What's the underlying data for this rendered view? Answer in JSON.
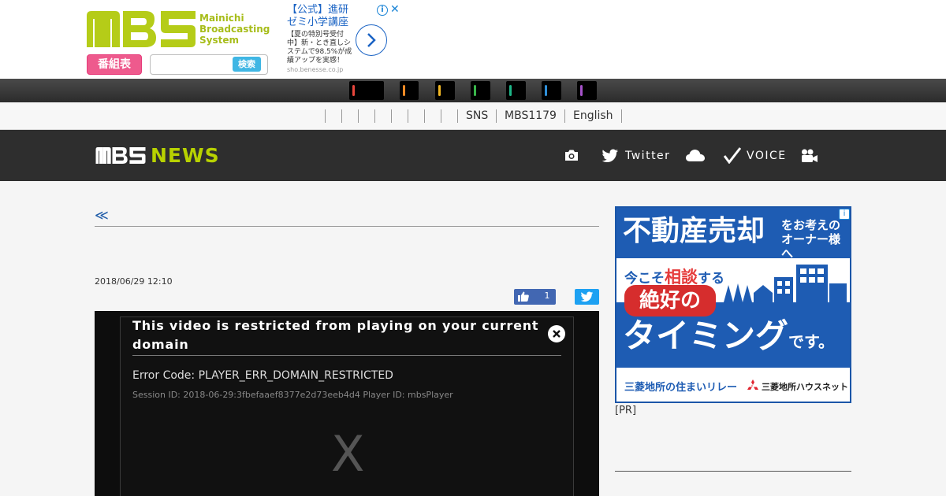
{
  "header": {
    "logo_sub_line1": "Mainichi",
    "logo_sub_line2": "Broadcasting",
    "logo_sub_line3": "System",
    "program_button": "番組表",
    "search_placeholder": "",
    "search_button": "検索"
  },
  "ad_top": {
    "title": "【公式】進研ゼミ小学講座",
    "body": "【夏の特別号受付中】新・とき直しシステムで98.5%が成績アップを実感！",
    "url": "sho.benesse.co.jp",
    "info": "i",
    "close": "✕"
  },
  "channels": [
    {
      "color": "#e8463c"
    },
    {
      "color": "#f08a24"
    },
    {
      "color": "#f2b824"
    },
    {
      "color": "#39b54a"
    },
    {
      "color": "#1db587"
    },
    {
      "color": "#2f8fd8"
    },
    {
      "color": "#a552c9"
    }
  ],
  "sub_nav": {
    "links": [
      "SNS",
      "MBS1179",
      "English"
    ]
  },
  "news_bar": {
    "logo_word": "NEWS",
    "twitter": "Twitter",
    "voice": "VOICE"
  },
  "article": {
    "breadcrumb": "≪",
    "title": "",
    "date": "2018/06/29 12:10",
    "like_count": "1"
  },
  "player": {
    "error_title": "This video is restricted from playing on your current domain",
    "error_code": "Error Code: PLAYER_ERR_DOMAIN_RESTRICTED",
    "session": "Session ID: 2018-06-29:3fbefaaef8377e2d73eeb4d4 Player ID: mbsPlayer",
    "x_mark": "X"
  },
  "side_ad": {
    "headline": "不動産売却",
    "headline_tail_1": "をお考えの",
    "headline_tail_2": "オーナー様へ",
    "line2_pre": "今こそ",
    "line2_bold": "相談",
    "line2_post": "する",
    "pill": "絶好の",
    "big": "タイミング",
    "desu": "です。",
    "footer_left": "三菱地所の住まいリレー",
    "footer_right": "三菱地所ハウスネット",
    "info": "i"
  },
  "pr_label": "[PR]",
  "side_heading": ""
}
